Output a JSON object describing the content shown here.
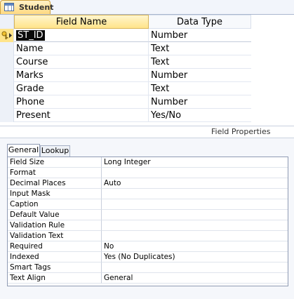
{
  "tab": {
    "title": "Student",
    "icon": "table-icon"
  },
  "grid": {
    "headers": {
      "field_name": "Field Name",
      "data_type": "Data Type"
    },
    "rows": [
      {
        "field": "ST_ID",
        "type": "Number",
        "primary_key": true,
        "selected": true
      },
      {
        "field": "Name",
        "type": "Text"
      },
      {
        "field": "Course",
        "type": "Text"
      },
      {
        "field": "Marks",
        "type": "Number"
      },
      {
        "field": "Grade",
        "type": "Text"
      },
      {
        "field": "Phone",
        "type": "Number"
      },
      {
        "field": "Present",
        "type": "Yes/No"
      }
    ]
  },
  "field_properties": {
    "title": "Field Properties",
    "tabs": [
      "General",
      "Lookup"
    ],
    "active_tab": "General",
    "rows": [
      {
        "label": "Field Size",
        "value": "Long Integer"
      },
      {
        "label": "Format",
        "value": ""
      },
      {
        "label": "Decimal Places",
        "value": "Auto"
      },
      {
        "label": "Input Mask",
        "value": ""
      },
      {
        "label": "Caption",
        "value": ""
      },
      {
        "label": "Default Value",
        "value": ""
      },
      {
        "label": "Validation Rule",
        "value": ""
      },
      {
        "label": "Validation Text",
        "value": ""
      },
      {
        "label": "Required",
        "value": "No"
      },
      {
        "label": "Indexed",
        "value": "Yes (No Duplicates)"
      },
      {
        "label": "Smart Tags",
        "value": ""
      },
      {
        "label": "Text Align",
        "value": "General"
      }
    ]
  },
  "colors": {
    "active_header": "#ffe48a",
    "selection": "#0a0a0a",
    "border": "#8f9bb3"
  }
}
